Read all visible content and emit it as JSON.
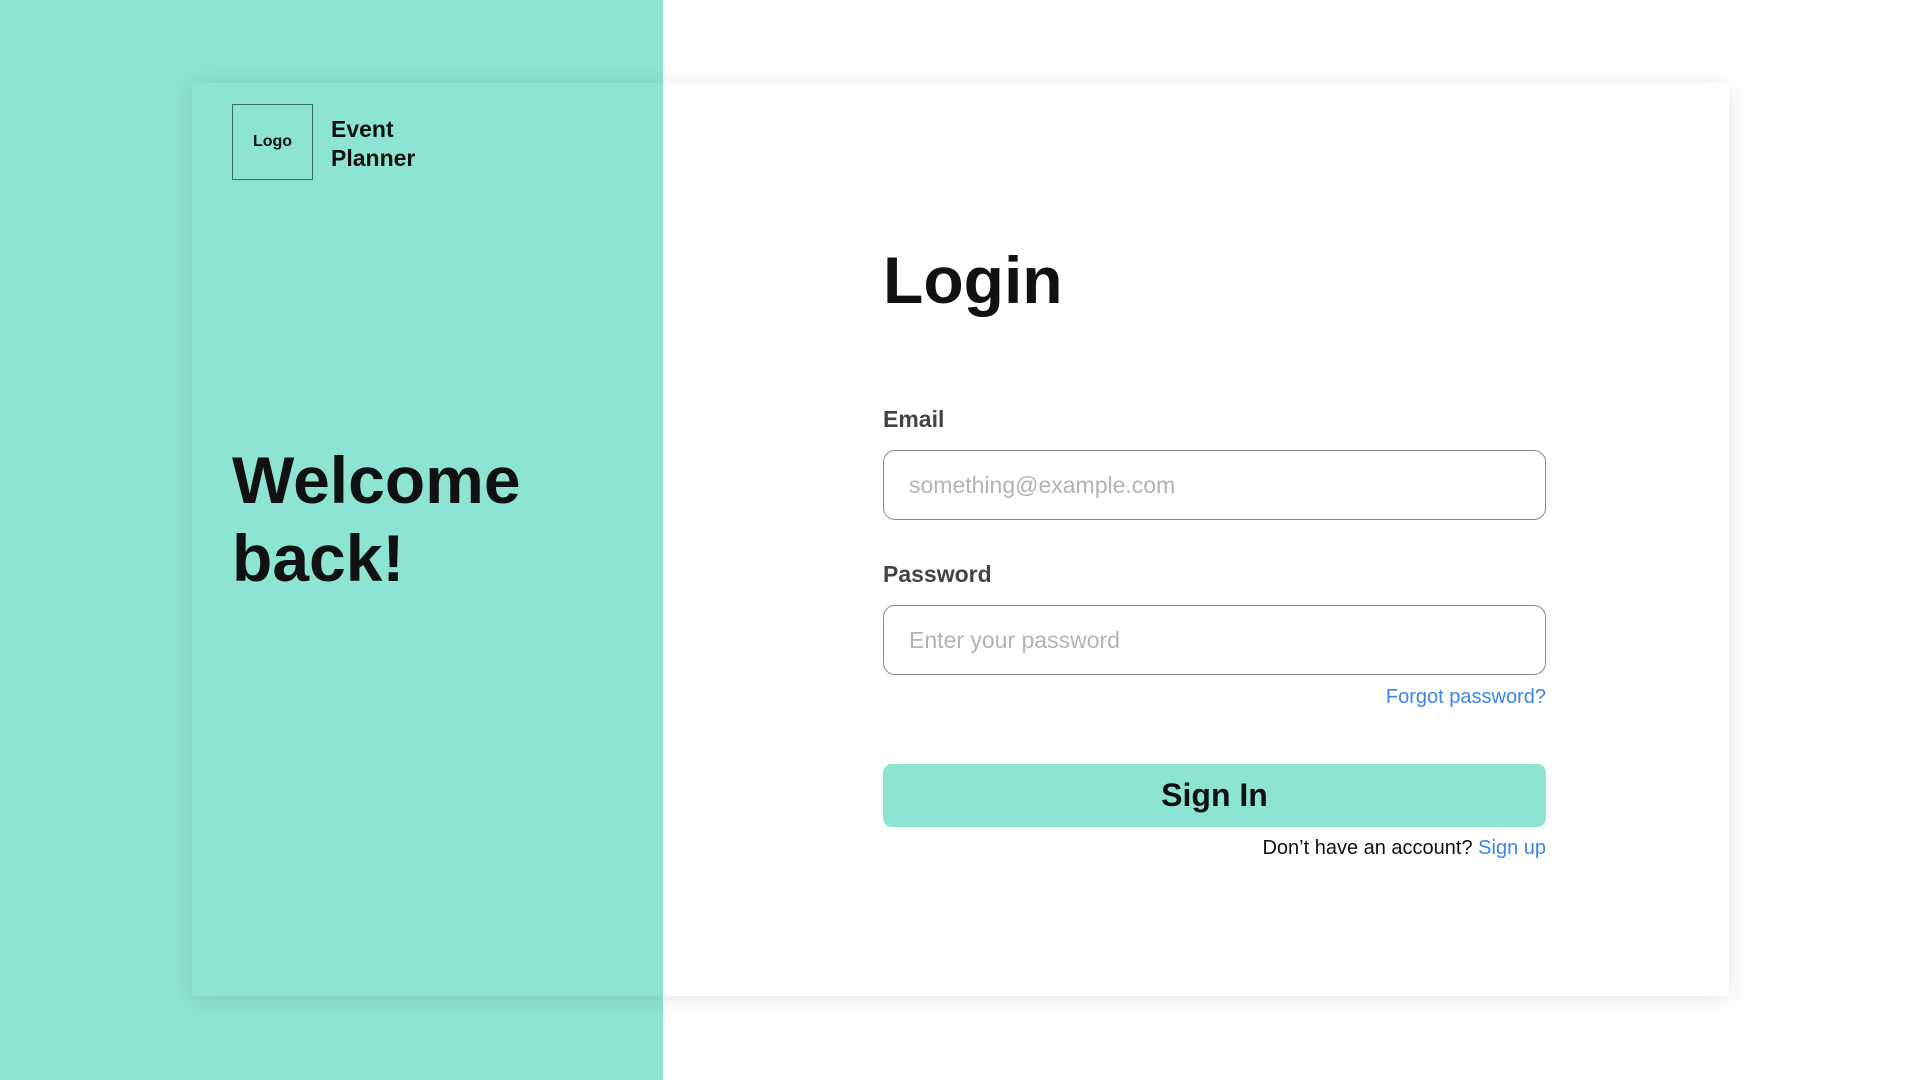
{
  "brand": {
    "logo_text": "Logo",
    "app_name": "Event Planner"
  },
  "welcome": {
    "heading": "Welcome back!"
  },
  "login": {
    "title": "Login",
    "email": {
      "label": "Email",
      "placeholder": "something@example.com",
      "value": ""
    },
    "password": {
      "label": "Password",
      "placeholder": "Enter your password",
      "value": ""
    },
    "forgot_password_label": "Forgot password?",
    "sign_in_label": "Sign In",
    "signup_prompt": "Don’t have an account?",
    "signup_link_label": "Sign up"
  },
  "colors": {
    "accent": "#8de4d3",
    "link": "#3a86e8",
    "text": "#111111",
    "label_text": "#444444",
    "placeholder": "#b3b3b3"
  }
}
